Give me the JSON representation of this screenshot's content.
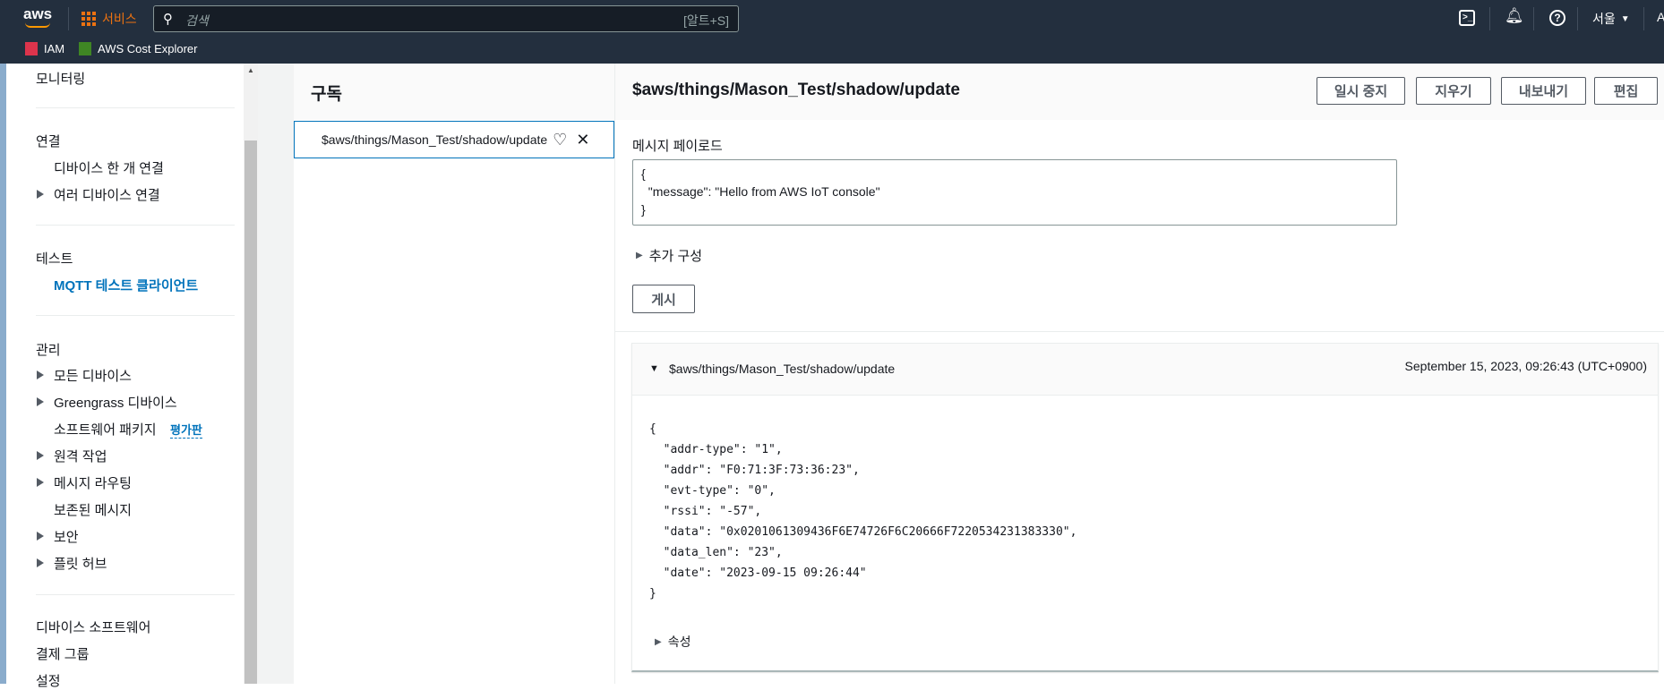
{
  "topnav": {
    "logo": "aws",
    "services": "서비스",
    "search_placeholder": "검색",
    "search_shortcut": "[알트+S]",
    "region": "서울",
    "account_initial": "A",
    "favorites": [
      {
        "label": "IAM"
      },
      {
        "label": "AWS Cost Explorer"
      }
    ]
  },
  "sidebar": {
    "monitoring": "모니터링",
    "connect": {
      "title": "연결",
      "items": [
        "디바이스 한 개 연결",
        "여러 디바이스 연결"
      ]
    },
    "test": {
      "title": "테스트",
      "items": [
        "MQTT 테스트 클라이언트"
      ]
    },
    "manage": {
      "title": "관리",
      "items": [
        "모든 디바이스",
        "Greengrass 디바이스",
        "소프트웨어 패키지",
        "원격 작업",
        "메시지 라우팅",
        "보존된 메시지",
        "보안",
        "플릿 허브"
      ],
      "preview_badge": "평가판"
    },
    "bottom": [
      "디바이스 소프트웨어",
      "결제 그룹",
      "설정"
    ]
  },
  "subscriptions": {
    "title": "구독",
    "items": [
      {
        "topic": "$aws/things/Mason_Test/shadow/update"
      }
    ]
  },
  "main": {
    "topic_title": "$aws/things/Mason_Test/shadow/update",
    "buttons": {
      "pause": "일시 중지",
      "clear": "지우기",
      "export": "내보내기",
      "edit": "편집"
    },
    "payload_label": "메시지 페이로드",
    "payload": "{\n  \"message\": \"Hello from AWS IoT console\"\n}",
    "additional_config": "추가 구성",
    "publish": "게시",
    "message": {
      "topic": "$aws/things/Mason_Test/shadow/update",
      "timestamp": "September 15, 2023, 09:26:43 (UTC+0900)",
      "body": "{\n  \"addr-type\": \"1\",\n  \"addr\": \"F0:71:3F:73:36:23\",\n  \"evt-type\": \"0\",\n  \"rssi\": \"-57\",\n  \"data\": \"0x0201061309436F6E74726F6C20666F7220534231383330\",\n  \"data_len\": \"23\",\n  \"date\": \"2023-09-15 09:26:44\"\n}",
      "properties": "속성"
    }
  }
}
